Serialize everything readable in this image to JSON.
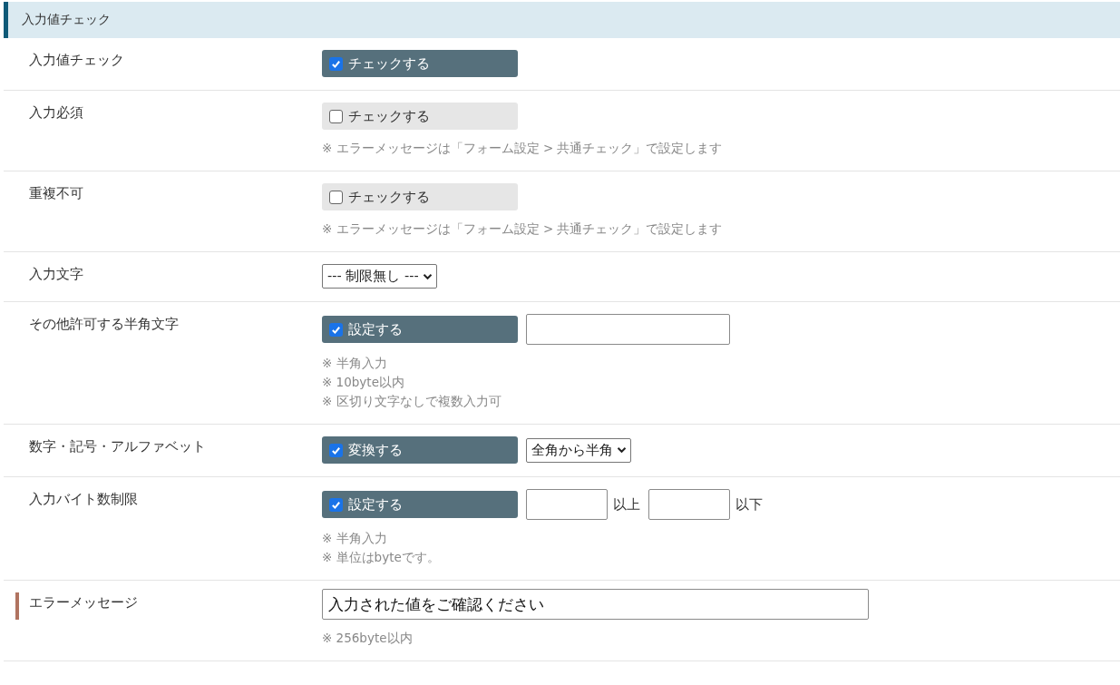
{
  "section": {
    "title": "入力値チェック"
  },
  "rows": [
    {
      "label": "入力値チェック",
      "accent": false,
      "controls": [
        {
          "kind": "check",
          "label": "チェックする",
          "checked": true
        }
      ],
      "notes": []
    },
    {
      "label": "入力必須",
      "accent": false,
      "controls": [
        {
          "kind": "check",
          "label": "チェックする",
          "checked": false
        }
      ],
      "notes": [
        "※ エラーメッセージは「フォーム設定 > 共通チェック」で設定します"
      ]
    },
    {
      "label": "重複不可",
      "accent": false,
      "controls": [
        {
          "kind": "check",
          "label": "チェックする",
          "checked": false
        }
      ],
      "notes": [
        "※ エラーメッセージは「フォーム設定 > 共通チェック」で設定します"
      ]
    },
    {
      "label": "入力文字",
      "accent": false,
      "controls": [
        {
          "kind": "select",
          "value": "--- 制限無し ---"
        }
      ],
      "notes": []
    },
    {
      "label": "その他許可する半角文字",
      "accent": false,
      "controls": [
        {
          "kind": "check",
          "label": "設定する",
          "checked": true
        },
        {
          "kind": "field"
        }
      ],
      "notes": [
        "※ 半角入力",
        "※ 10byte以内",
        "※ 区切り文字なしで複数入力可"
      ]
    },
    {
      "label": "数字・記号・アルファベット",
      "accent": false,
      "controls": [
        {
          "kind": "check",
          "label": "変換する",
          "checked": true
        },
        {
          "kind": "select",
          "value": "全角から半角"
        }
      ],
      "notes": []
    },
    {
      "label": "入力バイト数制限",
      "accent": false,
      "controls": [
        {
          "kind": "check",
          "label": "設定する",
          "checked": true
        },
        {
          "kind": "shortfield"
        },
        {
          "kind": "unit",
          "text": "以上"
        },
        {
          "kind": "shortfield"
        },
        {
          "kind": "unit",
          "text": "以下"
        }
      ],
      "notes": [
        "※ 半角入力",
        "※ 単位はbyteです。"
      ]
    },
    {
      "label": "エラーメッセージ",
      "accent": true,
      "controls": [
        {
          "kind": "longfield",
          "value": "入力された値をご確認ください"
        }
      ],
      "notes": [
        "※ 256byte以内"
      ]
    }
  ]
}
